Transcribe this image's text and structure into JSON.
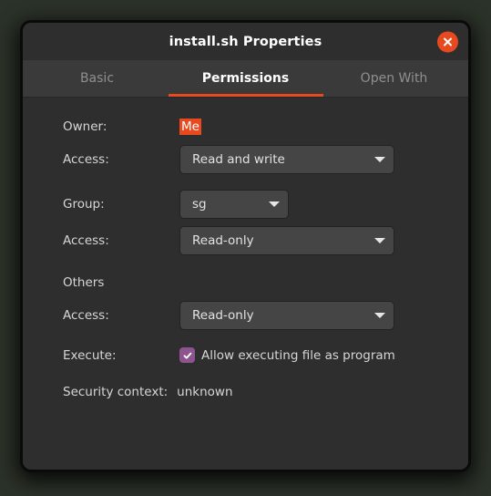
{
  "window": {
    "title": "install.sh Properties",
    "close_icon": "close-icon"
  },
  "tabs": [
    {
      "label": "Basic",
      "active": false
    },
    {
      "label": "Permissions",
      "active": true
    },
    {
      "label": "Open With",
      "active": false
    }
  ],
  "permissions": {
    "owner": {
      "label": "Owner:",
      "value": "Me",
      "selected": true
    },
    "owner_access": {
      "label": "Access:",
      "value": "Read and write"
    },
    "group": {
      "label": "Group:",
      "value": "sg"
    },
    "group_access": {
      "label": "Access:",
      "value": "Read-only"
    },
    "others": {
      "label": "Others"
    },
    "others_access": {
      "label": "Access:",
      "value": "Read-only"
    },
    "execute": {
      "label": "Execute:",
      "checkbox_label": "Allow executing file as program",
      "checked": true
    },
    "security_context": {
      "label": "Security context:",
      "value": "unknown"
    }
  },
  "colors": {
    "accent": "#e8491f",
    "checkbox": "#8e5490",
    "window_bg": "#2e2e2e",
    "tabbar_bg": "#3a3a3a",
    "desktop_bg": "#2b3229"
  }
}
